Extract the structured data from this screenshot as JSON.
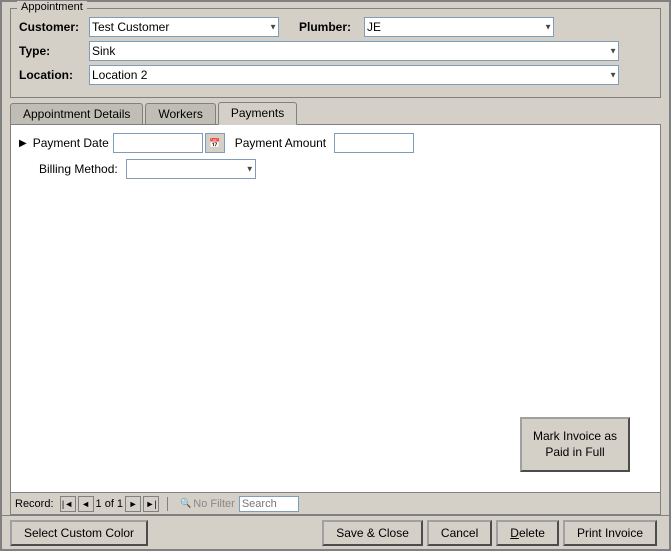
{
  "dialog": {
    "appointment_group_label": "Appointment",
    "customer_label": "Customer:",
    "customer_value": "Test Customer",
    "plumber_label": "Plumber:",
    "plumber_value": "JE",
    "type_label": "Type:",
    "type_value": "Sink",
    "location_label": "Location:",
    "location_value": "Location 2"
  },
  "tabs": {
    "tab1_label": "Appointment Details",
    "tab2_label": "Workers",
    "tab3_label": "Payments"
  },
  "payments": {
    "payment_date_label": "Payment Date",
    "payment_date_value": "",
    "payment_amount_label": "Payment Amount",
    "payment_amount_value": "",
    "billing_method_label": "Billing Method:",
    "billing_method_value": "",
    "mark_invoice_label": "Mark Invoice as Paid in Full"
  },
  "record_nav": {
    "label": "Record:",
    "first_label": "◄◄",
    "prev_label": "◄",
    "record_info": "1 of 1",
    "next_label": "►",
    "last_label": "►►",
    "no_filter_label": "No Filter",
    "search_placeholder": "Search"
  },
  "bottom_bar": {
    "select_color_label": "Select Custom Color",
    "save_close_label": "Save & Close",
    "cancel_label": "Cancel",
    "delete_label": "Delete",
    "print_invoice_label": "Print Invoice"
  }
}
